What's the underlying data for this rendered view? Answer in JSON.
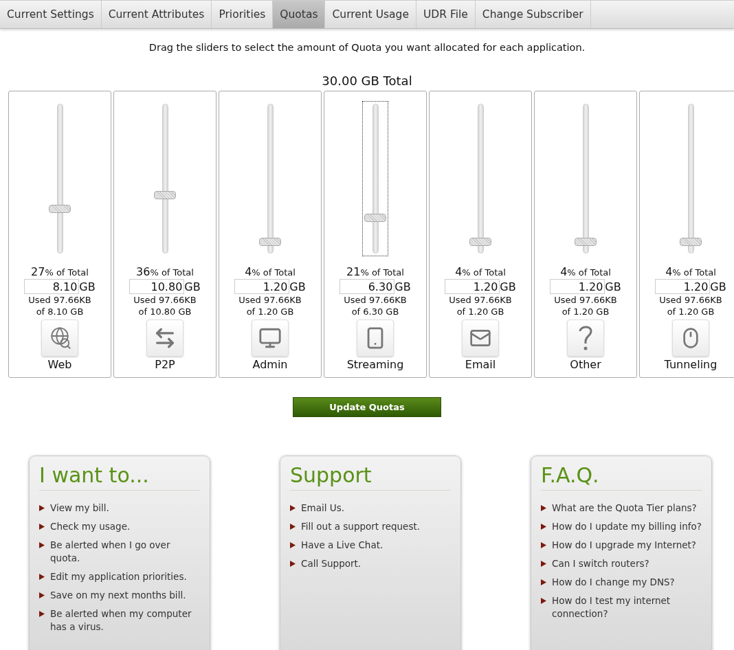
{
  "tabs": [
    {
      "label": "Current Settings",
      "selected": false
    },
    {
      "label": "Current Attributes",
      "selected": false
    },
    {
      "label": "Priorities",
      "selected": false
    },
    {
      "label": "Quotas",
      "selected": true
    },
    {
      "label": "Current Usage",
      "selected": false
    },
    {
      "label": "UDR File",
      "selected": false
    },
    {
      "label": "Change Subscriber",
      "selected": false
    }
  ],
  "instruction": "Drag the sliders to select the amount of Quota you want allocated for each application.",
  "total": "30.00 GB Total",
  "applications": [
    {
      "name": "Web",
      "percent": "27",
      "percent_label": "% of Total",
      "value": "8.10",
      "unit": "GB",
      "used": "Used 97.66KB",
      "of": "of 8.10 GB",
      "level": 0.28,
      "focused": false
    },
    {
      "name": "P2P",
      "percent": "36",
      "percent_label": "% of Total",
      "value": "10.80",
      "unit": "GB",
      "used": "Used 97.66KB",
      "of": "of 10.80 GB",
      "level": 0.38,
      "focused": false
    },
    {
      "name": "Admin",
      "percent": "4",
      "percent_label": "% of Total",
      "value": "1.20",
      "unit": "GB",
      "used": "Used 97.66KB",
      "of": "of 1.20 GB",
      "level": 0.05,
      "focused": false
    },
    {
      "name": "Streaming",
      "percent": "21",
      "percent_label": "% of Total",
      "value": "6.30",
      "unit": "GB",
      "used": "Used 97.66KB",
      "of": "of 6.30 GB",
      "level": 0.22,
      "focused": true
    },
    {
      "name": "Email",
      "percent": "4",
      "percent_label": "% of Total",
      "value": "1.20",
      "unit": "GB",
      "used": "Used 97.66KB",
      "of": "of 1.20 GB",
      "level": 0.05,
      "focused": false
    },
    {
      "name": "Other",
      "percent": "4",
      "percent_label": "% of Total",
      "value": "1.20",
      "unit": "GB",
      "used": "Used 97.66KB",
      "of": "of 1.20 GB",
      "level": 0.05,
      "focused": false
    },
    {
      "name": "Tunneling",
      "percent": "4",
      "percent_label": "% of Total",
      "value": "1.20",
      "unit": "GB",
      "used": "Used 97.66KB",
      "of": "of 1.20 GB",
      "level": 0.05,
      "focused": false
    }
  ],
  "update_button": "Update Quotas",
  "panels": [
    {
      "title": "I want to...",
      "links": [
        "View my bill.",
        "Check my usage.",
        "Be alerted when I go over quota.",
        "Edit my application priorities.",
        "Save on my next months bill.",
        "Be alerted when my computer has a virus."
      ]
    },
    {
      "title": "Support",
      "links": [
        "Email Us.",
        "Fill out a support request.",
        "Have a Live Chat.",
        "Call Support."
      ]
    },
    {
      "title": "F.A.Q.",
      "links": [
        "What are the Quota Tier plans?",
        "How do I update my billing info?",
        "How do I upgrade my Internet?",
        "Can I switch routers?",
        "How do I change my DNS?",
        "How do I test my internet connection?"
      ]
    }
  ]
}
